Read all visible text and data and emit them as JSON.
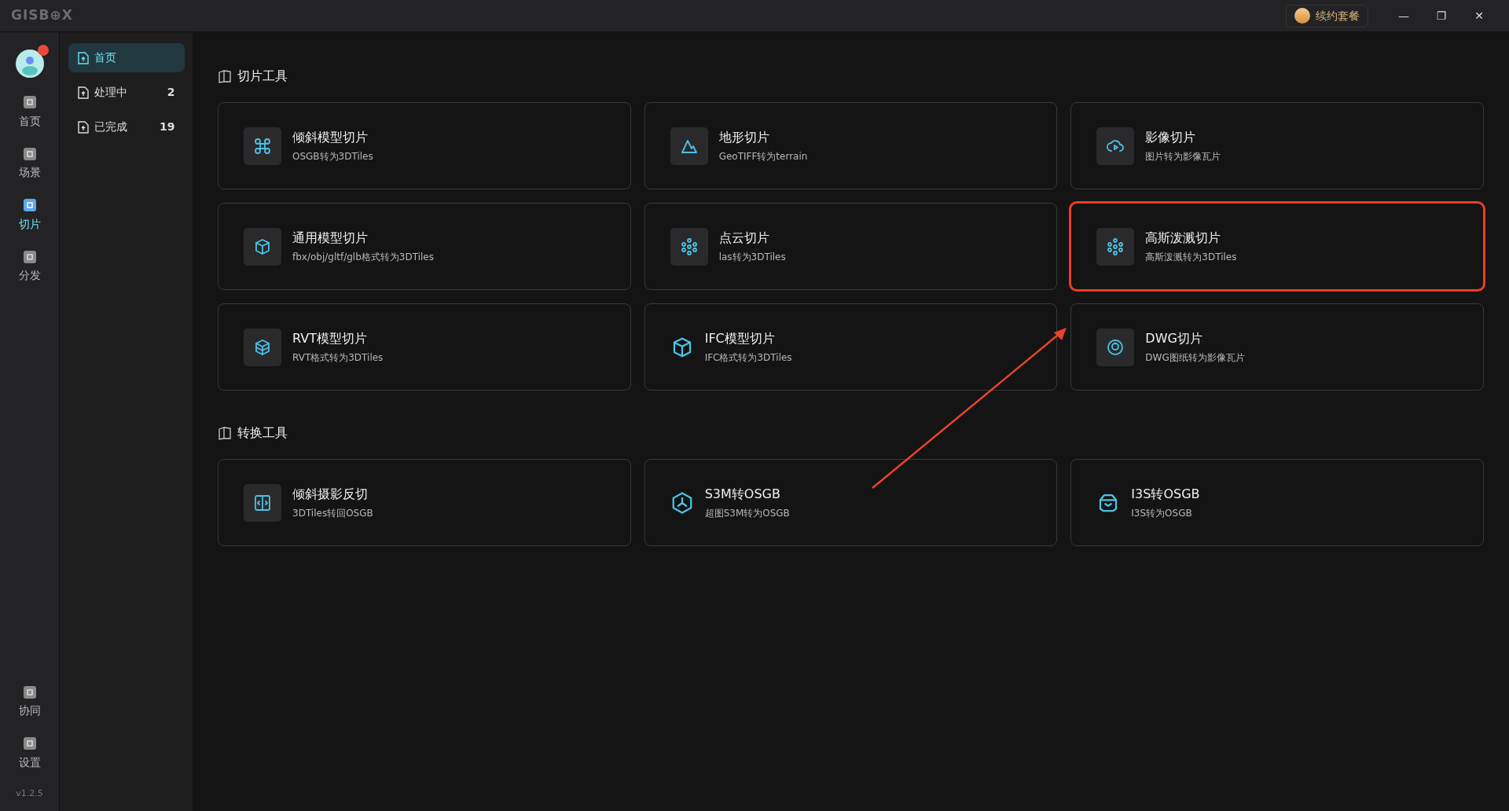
{
  "window": {
    "logo": "GISB⊕X",
    "renew_button": "续约套餐",
    "controls": [
      "—",
      "❐",
      "✕"
    ]
  },
  "rail": {
    "top": [
      {
        "label": "首页",
        "selected": false
      },
      {
        "label": "场景",
        "selected": false
      },
      {
        "label": "切片",
        "selected": true
      },
      {
        "label": "分发",
        "selected": false
      }
    ],
    "bottom": [
      {
        "label": "协同",
        "selected": false
      },
      {
        "label": "设置",
        "selected": false
      }
    ],
    "version": "v1.2.5"
  },
  "sidebar": {
    "items": [
      {
        "label": "首页",
        "selected": true
      },
      {
        "label": "处理中",
        "count": "2",
        "selected": false
      },
      {
        "label": "已完成",
        "count": "19",
        "selected": false
      }
    ]
  },
  "sections": [
    {
      "title": "切片工具",
      "cards": [
        {
          "title": "倾斜模型切片",
          "subtitle": "OSGB转为3DTiles",
          "kind": "tile",
          "highlighted": false
        },
        {
          "title": "地形切片",
          "subtitle": "GeoTIFF转为terrain",
          "kind": "tile",
          "highlighted": false
        },
        {
          "title": "影像切片",
          "subtitle": "图片转为影像瓦片",
          "kind": "tile",
          "highlighted": false
        },
        {
          "title": "通用模型切片",
          "subtitle": "fbx/obj/gltf/glb格式转为3DTiles",
          "kind": "tile",
          "highlighted": false
        },
        {
          "title": "点云切片",
          "subtitle": "las转为3DTiles",
          "kind": "tile",
          "highlighted": false
        },
        {
          "title": "高斯泼溅切片",
          "subtitle": "高斯泼溅转为3DTiles",
          "kind": "tile",
          "highlighted": true
        },
        {
          "title": "RVT模型切片",
          "subtitle": "RVT格式转为3DTiles",
          "kind": "tile",
          "highlighted": false
        },
        {
          "title": "IFC模型切片",
          "subtitle": "IFC格式转为3DTiles",
          "kind": "plain",
          "highlighted": false
        },
        {
          "title": "DWG切片",
          "subtitle": "DWG图纸转为影像瓦片",
          "kind": "tile",
          "highlighted": false
        }
      ]
    },
    {
      "title": "转换工具",
      "cards": [
        {
          "title": "倾斜摄影反切",
          "subtitle": "3DTiles转回OSGB",
          "kind": "tile",
          "highlighted": false
        },
        {
          "title": "S3M转OSGB",
          "subtitle": "超图S3M转为OSGB",
          "kind": "plain",
          "highlighted": false
        },
        {
          "title": "I3S转OSGB",
          "subtitle": "I3S转为OSGB",
          "kind": "plain",
          "highlighted": false
        }
      ]
    }
  ]
}
